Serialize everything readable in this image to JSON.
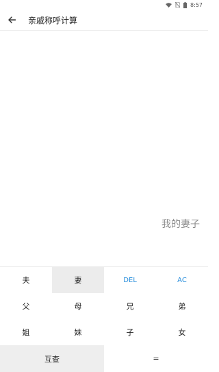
{
  "status": {
    "time": "8:57"
  },
  "header": {
    "title": "亲戚称呼计算"
  },
  "display": {
    "result": "我的妻子"
  },
  "keypad": {
    "row1": [
      "夫",
      "妻",
      "DEL",
      "AC"
    ],
    "row2": [
      "父",
      "母",
      "兄",
      "弟"
    ],
    "row3": [
      "姐",
      "妹",
      "子",
      "女"
    ],
    "row4": [
      "互查",
      "="
    ]
  },
  "colors": {
    "accent": "#2a8fdc",
    "pressed": "#ececec"
  }
}
